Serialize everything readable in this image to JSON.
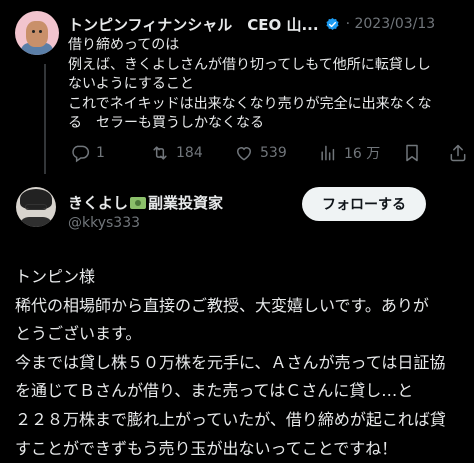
{
  "tweet1": {
    "author_name": "トンピンフィナンシャル　CEO 山...",
    "date": "· 2023/03/13",
    "text": "借り締めってのは\n例えば、きくよしさんが借り切ってしもて他所に転貸しし\nないようにすること\nこれでネイキッドは出来なくなり売りが完全に出来なくな\nる　セラーも買うしかなくなる",
    "actions": {
      "reply_count": "1",
      "retweet_count": "184",
      "like_count": "539",
      "view_count": "16 万"
    },
    "icons": [
      "reply-icon",
      "retweet-icon",
      "like-icon",
      "views-icon",
      "bookmark-icon",
      "share-icon"
    ]
  },
  "tweet2": {
    "author_name_pre": "きくよし",
    "author_name_post": "副業投資家",
    "handle": "@kkys333",
    "follow_label": "フォローする",
    "text": "トンピン様\n稀代の相場師から直接のご教授、大変嬉しいです。ありが\nとうございます。\n今までは貸し株５０万株を元手に、Ａさんが売っては日証協\nを通じてＢさんが借り、また売ってはＣさんに貸し…と\n２２８万株まで膨れ上がっていたが、借り締めが起これば貸\nすことができずもう売り玉が出ないってことですね！"
  },
  "colors": {
    "background": "#000000",
    "text": "#e7e9ea",
    "muted": "#71767b",
    "verified": "#1d9bf0",
    "follow_bg": "#eff3f4"
  }
}
